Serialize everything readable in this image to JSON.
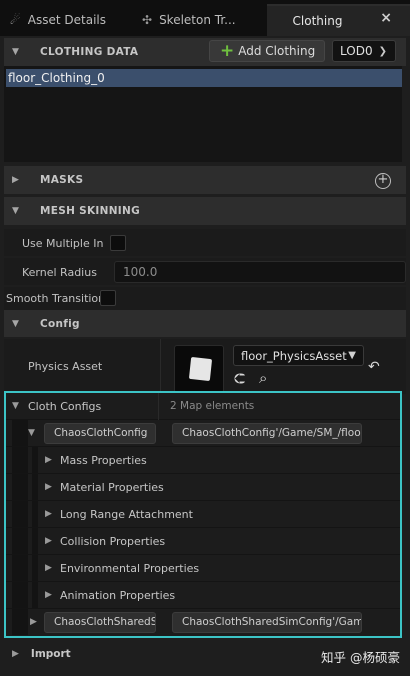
{
  "tabs": [
    {
      "label": "Asset Details",
      "icon": "asset-details-icon"
    },
    {
      "label": "Skeleton Tr...",
      "icon": "skeleton-tree-icon"
    },
    {
      "label": "Clothing",
      "icon": ""
    }
  ],
  "tab_close": "×",
  "clothing_data": {
    "title": "CLOTHING DATA",
    "add_button": "Add Clothing",
    "lod": "LOD0",
    "items": [
      "floor_Clothing_0"
    ]
  },
  "masks": {
    "title": "MASKS"
  },
  "mesh_skinning": {
    "title": "MESH SKINNING",
    "use_multiple_label": "Use Multiple In",
    "kernel_radius_label": "Kernel Radius",
    "kernel_radius_value": "100.0",
    "smooth_transition_label": "Smooth Transition"
  },
  "config": {
    "title": "Config",
    "physics_asset_label": "Physics Asset",
    "physics_asset_value": "floor_PhysicsAsset"
  },
  "cloth_configs": {
    "label": "Cloth Configs",
    "count": "2 Map elements",
    "chaos_key": "ChaosClothConfig",
    "chaos_value": "ChaosClothConfig'/Game/SM_/floor",
    "groups": [
      "Mass Properties",
      "Material Properties",
      "Long Range Attachment",
      "Collision Properties",
      "Environmental Properties",
      "Animation Properties"
    ],
    "shared_key": "ChaosClothSharedS",
    "shared_value": "ChaosClothSharedSimConfig'/Gam"
  },
  "import": {
    "title": "Import"
  },
  "watermark": "知乎 @杨硕豪",
  "colors": {
    "highlight_border": "#3cc4c6",
    "selection": "#3b4f6c",
    "add_icon": "#6fbf3f"
  }
}
